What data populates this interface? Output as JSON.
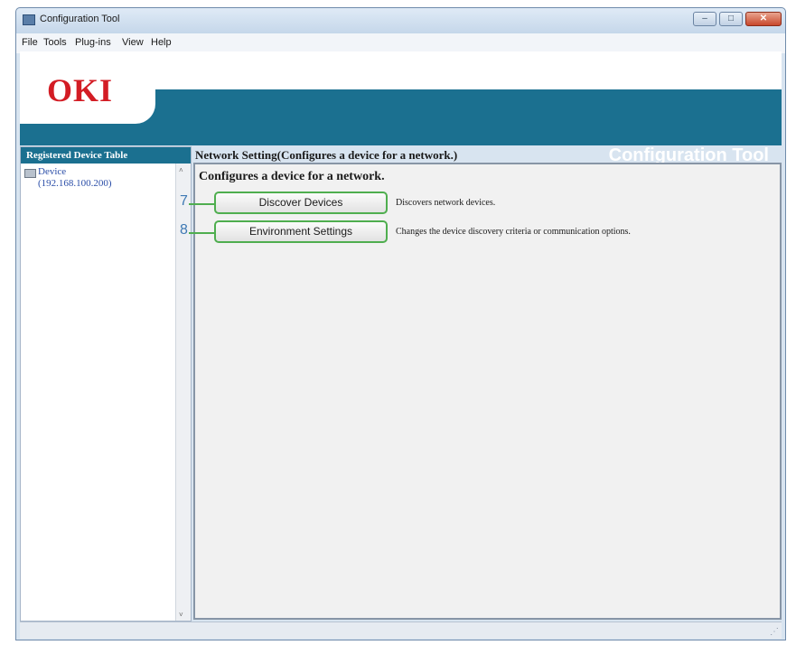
{
  "window": {
    "title": "Configuration Tool",
    "controls": {
      "minimize": "–",
      "maximize": "□",
      "close": "✕"
    }
  },
  "menu": [
    "File",
    "Tools",
    "Plug-ins",
    "View",
    "Help"
  ],
  "banner": {
    "logo": "OKI",
    "title": "Configuration Tool"
  },
  "sidebar": {
    "header": "Registered Device Table",
    "devices": [
      {
        "name": "Device",
        "address": "(192.168.100.200)"
      }
    ],
    "scroll_up": "˄",
    "scroll_down": "˅"
  },
  "main": {
    "header": "Network Setting(Configures a device for a network.)",
    "heading": "Configures a device for a network.",
    "actions": [
      {
        "callout": "7",
        "label": "Discover Devices",
        "description": "Discovers network devices."
      },
      {
        "callout": "8",
        "label": "Environment Settings",
        "description": "Changes the device discovery criteria or communication options."
      }
    ]
  },
  "colors": {
    "banner_teal": "#1b7090",
    "logo_red": "#d31c24",
    "highlight_green": "#4fae4f",
    "callout_blue": "#3e79b4"
  },
  "icons": [
    "app-icon",
    "printer-device-icon",
    "scroll-up-arrow-icon",
    "scroll-down-arrow-icon",
    "resize-grip-icon"
  ]
}
